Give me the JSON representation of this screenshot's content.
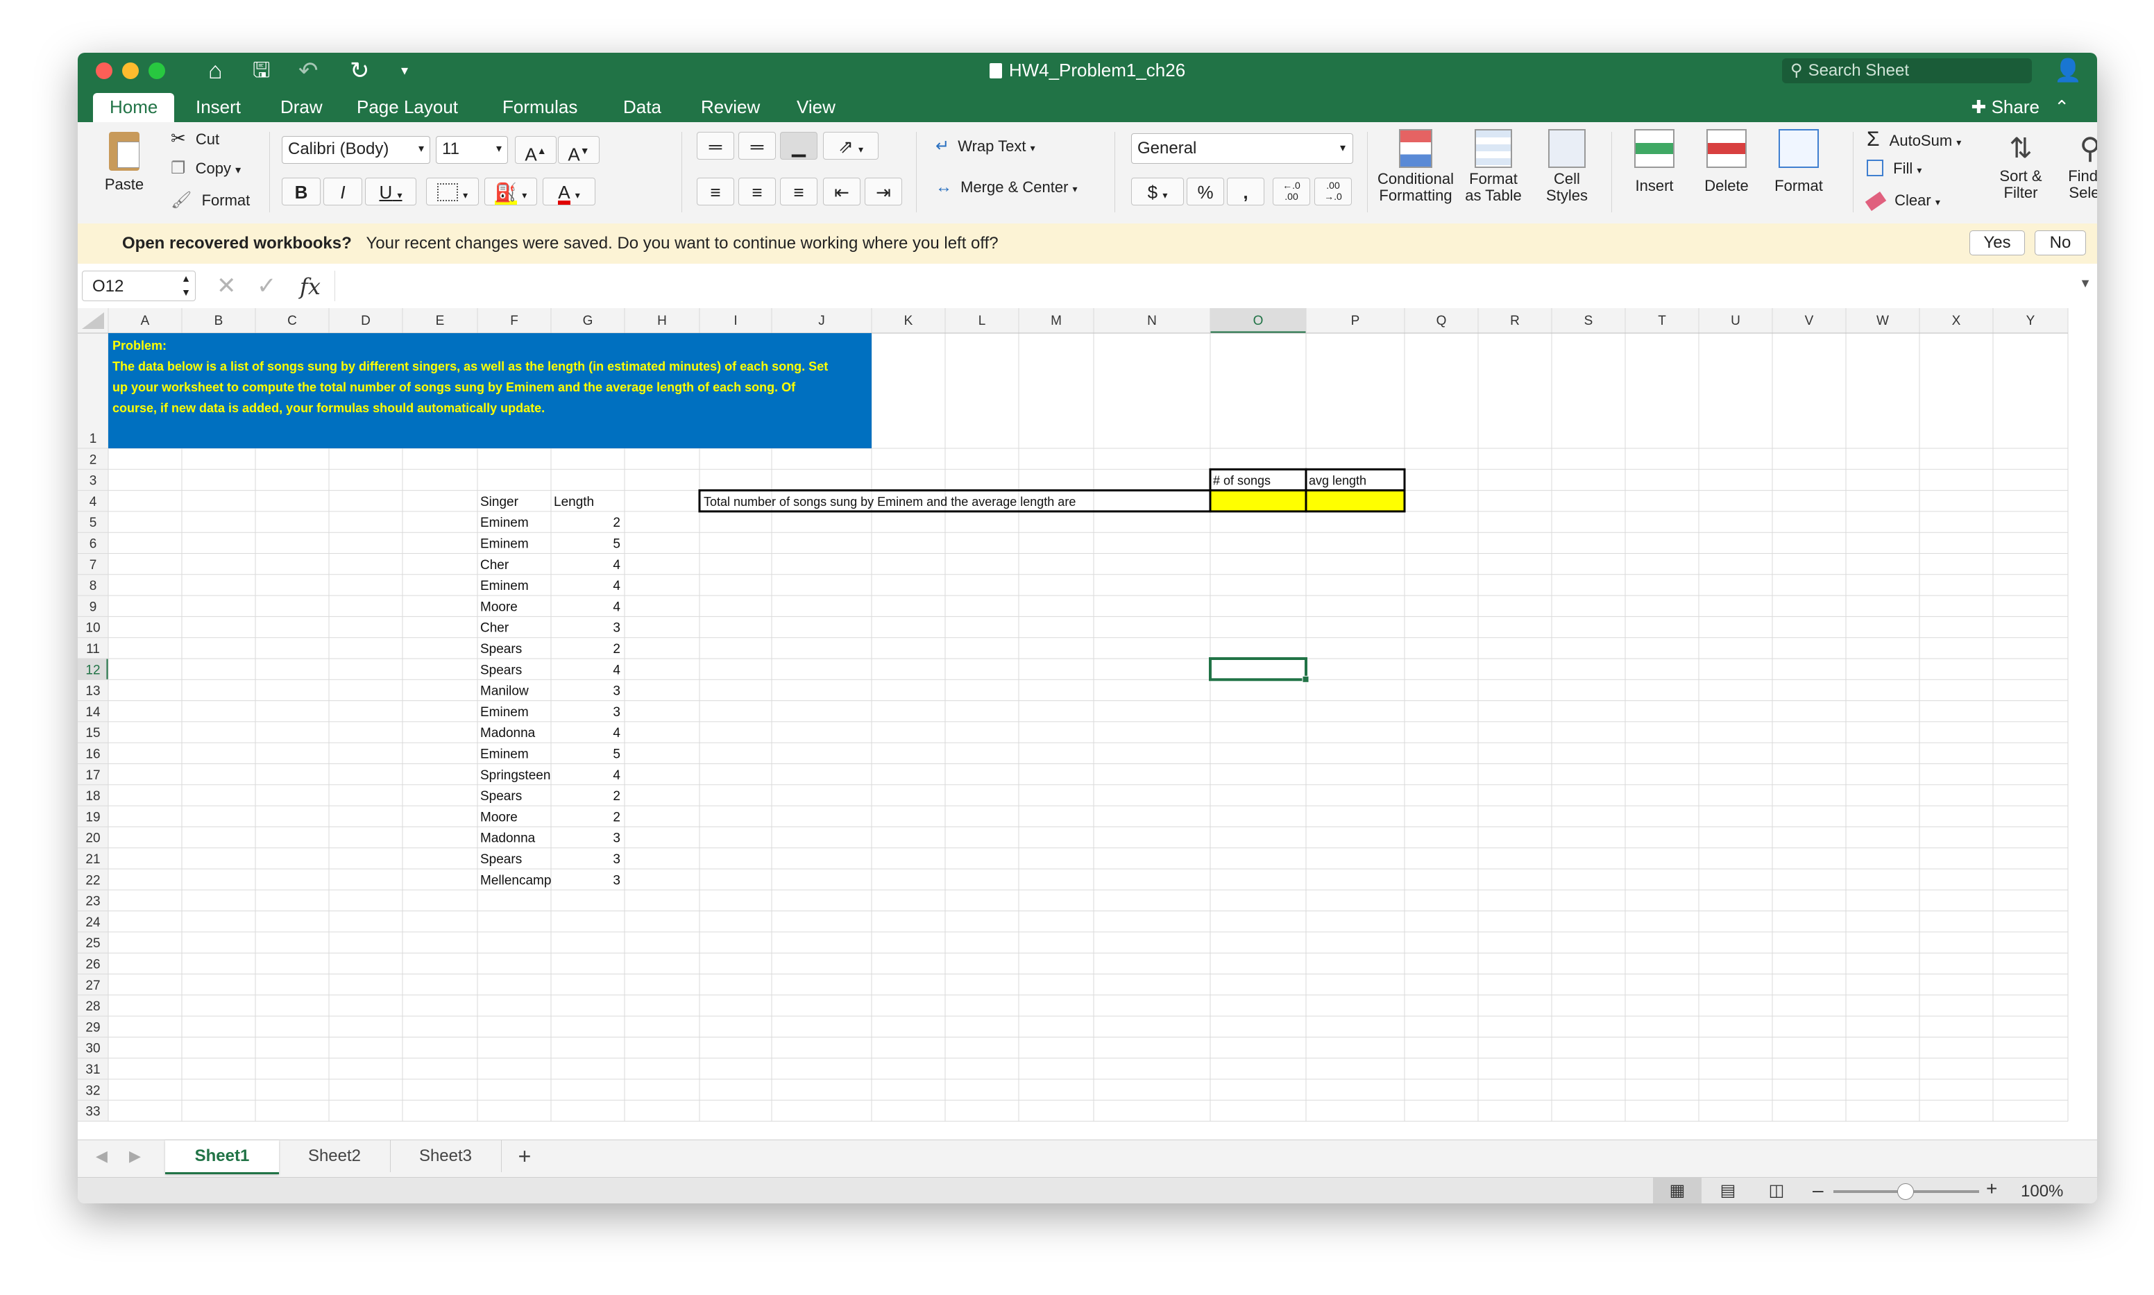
{
  "window": {
    "title": "HW4_Problem1_ch26"
  },
  "search": {
    "placeholder": "Search Sheet"
  },
  "tabs": [
    "Home",
    "Insert",
    "Draw",
    "Page Layout",
    "Formulas",
    "Data",
    "Review",
    "View"
  ],
  "share_label": "Share",
  "ribbon": {
    "paste": "Paste",
    "cut": "Cut",
    "copy": "Copy",
    "format_painter": "Format",
    "font_name": "Calibri (Body)",
    "font_size": "11",
    "bold": "B",
    "italic": "I",
    "underline": "U",
    "wrap_text": "Wrap Text",
    "merge_center": "Merge & Center",
    "number_format": "General",
    "dollar": "$",
    "percent": "%",
    "comma": ",",
    "inc_decimal": "←.0\n.00",
    "dec_decimal": ".00\n→.0",
    "conditional_formatting": [
      "Conditional",
      "Formatting"
    ],
    "format_as_table": [
      "Format",
      "as Table"
    ],
    "cell_styles": [
      "Cell",
      "Styles"
    ],
    "insert": "Insert",
    "delete": "Delete",
    "format": "Format",
    "autosum": "AutoSum",
    "fill": "Fill",
    "clear": "Clear",
    "sort_filter": [
      "Sort &",
      "Filter"
    ],
    "find_select": [
      "Find &",
      "Select"
    ]
  },
  "notification": {
    "title": "Open recovered workbooks?",
    "message": "Your recent changes were saved. Do you want to continue working where you left off?",
    "yes": "Yes",
    "no": "No"
  },
  "formula_bar": {
    "name_box": "O12",
    "fx": "fx",
    "value": ""
  },
  "columns": [
    "A",
    "B",
    "C",
    "D",
    "E",
    "F",
    "G",
    "H",
    "I",
    "J",
    "K",
    "L",
    "M",
    "N",
    "O",
    "P",
    "Q",
    "R",
    "S",
    "T",
    "U",
    "V",
    "W",
    "X",
    "Y"
  ],
  "rows": [
    "1",
    "2",
    "3",
    "4",
    "5",
    "6",
    "7",
    "8",
    "9",
    "10",
    "11",
    "12",
    "13",
    "14",
    "15",
    "16",
    "17",
    "18",
    "19",
    "20",
    "21",
    "22",
    "23",
    "24",
    "25",
    "26",
    "27",
    "28",
    "29",
    "30",
    "31",
    "32",
    "33"
  ],
  "problem": {
    "label": "Problem:",
    "lines": [
      "The data below is a list of songs sung by different singers, as well as the length (in estimated minutes) of each song. Set",
      "up your worksheet to compute the total number of songs sung by Eminem and the average length of each song. Of",
      "course, if new data is added, your formulas should automatically update."
    ],
    "fill": "#0070c0",
    "text_color": "#ffff00"
  },
  "table": {
    "headers": [
      "Singer",
      "Length"
    ],
    "rows": [
      [
        "Eminem",
        "2"
      ],
      [
        "Eminem",
        "5"
      ],
      [
        "Cher",
        "4"
      ],
      [
        "Eminem",
        "4"
      ],
      [
        "Moore",
        "4"
      ],
      [
        "Cher",
        "3"
      ],
      [
        "Spears",
        "2"
      ],
      [
        "Spears",
        "4"
      ],
      [
        "Manilow",
        "3"
      ],
      [
        "Eminem",
        "3"
      ],
      [
        "Madonna",
        "4"
      ],
      [
        "Eminem",
        "5"
      ],
      [
        "Springsteen",
        "4"
      ],
      [
        "Spears",
        "2"
      ],
      [
        "Moore",
        "2"
      ],
      [
        "Madonna",
        "3"
      ],
      [
        "Spears",
        "3"
      ],
      [
        "Mellencamp",
        "3"
      ]
    ]
  },
  "summary": {
    "label": "Total number of songs sung by Eminem and the average length are",
    "col1": "# of songs",
    "col2": "avg length",
    "highlight": "#ffff00"
  },
  "sheets": [
    "Sheet1",
    "Sheet2",
    "Sheet3"
  ],
  "active_sheet": "Sheet1",
  "zoom": "100%",
  "colors": {
    "accent": "#217346"
  }
}
